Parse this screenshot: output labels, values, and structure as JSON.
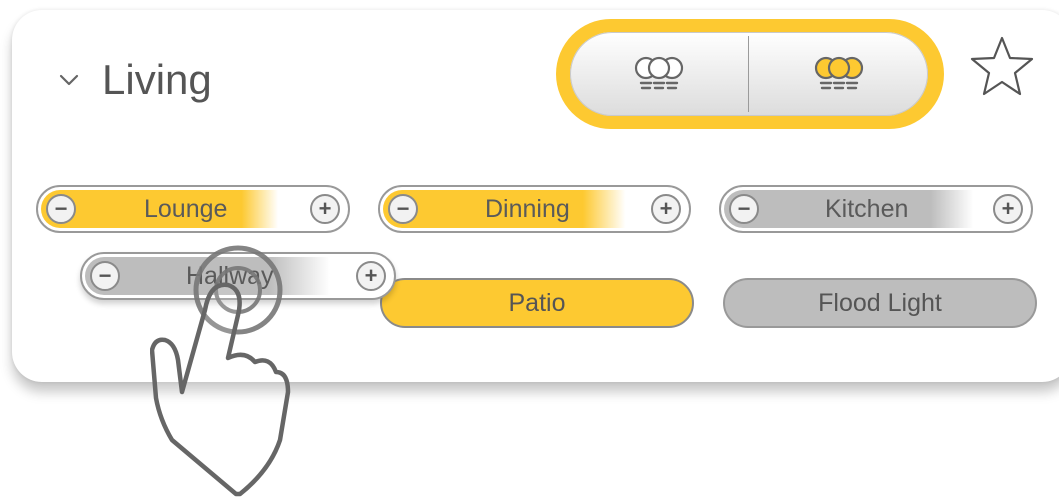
{
  "room": {
    "name": "Living"
  },
  "scenes": [
    {
      "label": "",
      "icon": "bulbs-off-icon"
    },
    {
      "label": "",
      "icon": "bulbs-on-icon"
    }
  ],
  "favorite": {
    "icon": "star-icon"
  },
  "lights": [
    {
      "name": "Lounge",
      "type": "dimmer",
      "on": true
    },
    {
      "name": "Dinning",
      "type": "dimmer",
      "on": true
    },
    {
      "name": "Kitchen",
      "type": "dimmer",
      "on": false
    },
    {
      "name": "Hallway",
      "type": "dimmer",
      "on": false
    },
    {
      "name": "Patio",
      "type": "toggle",
      "on": true
    },
    {
      "name": "Flood Light",
      "type": "toggle",
      "on": false
    }
  ],
  "controls": {
    "minus": "−",
    "plus": "+"
  },
  "colors": {
    "accent": "#fdc931",
    "off": "#bdbdbd",
    "text": "#555555"
  },
  "overlay": {
    "icon": "tap-gesture-icon"
  }
}
